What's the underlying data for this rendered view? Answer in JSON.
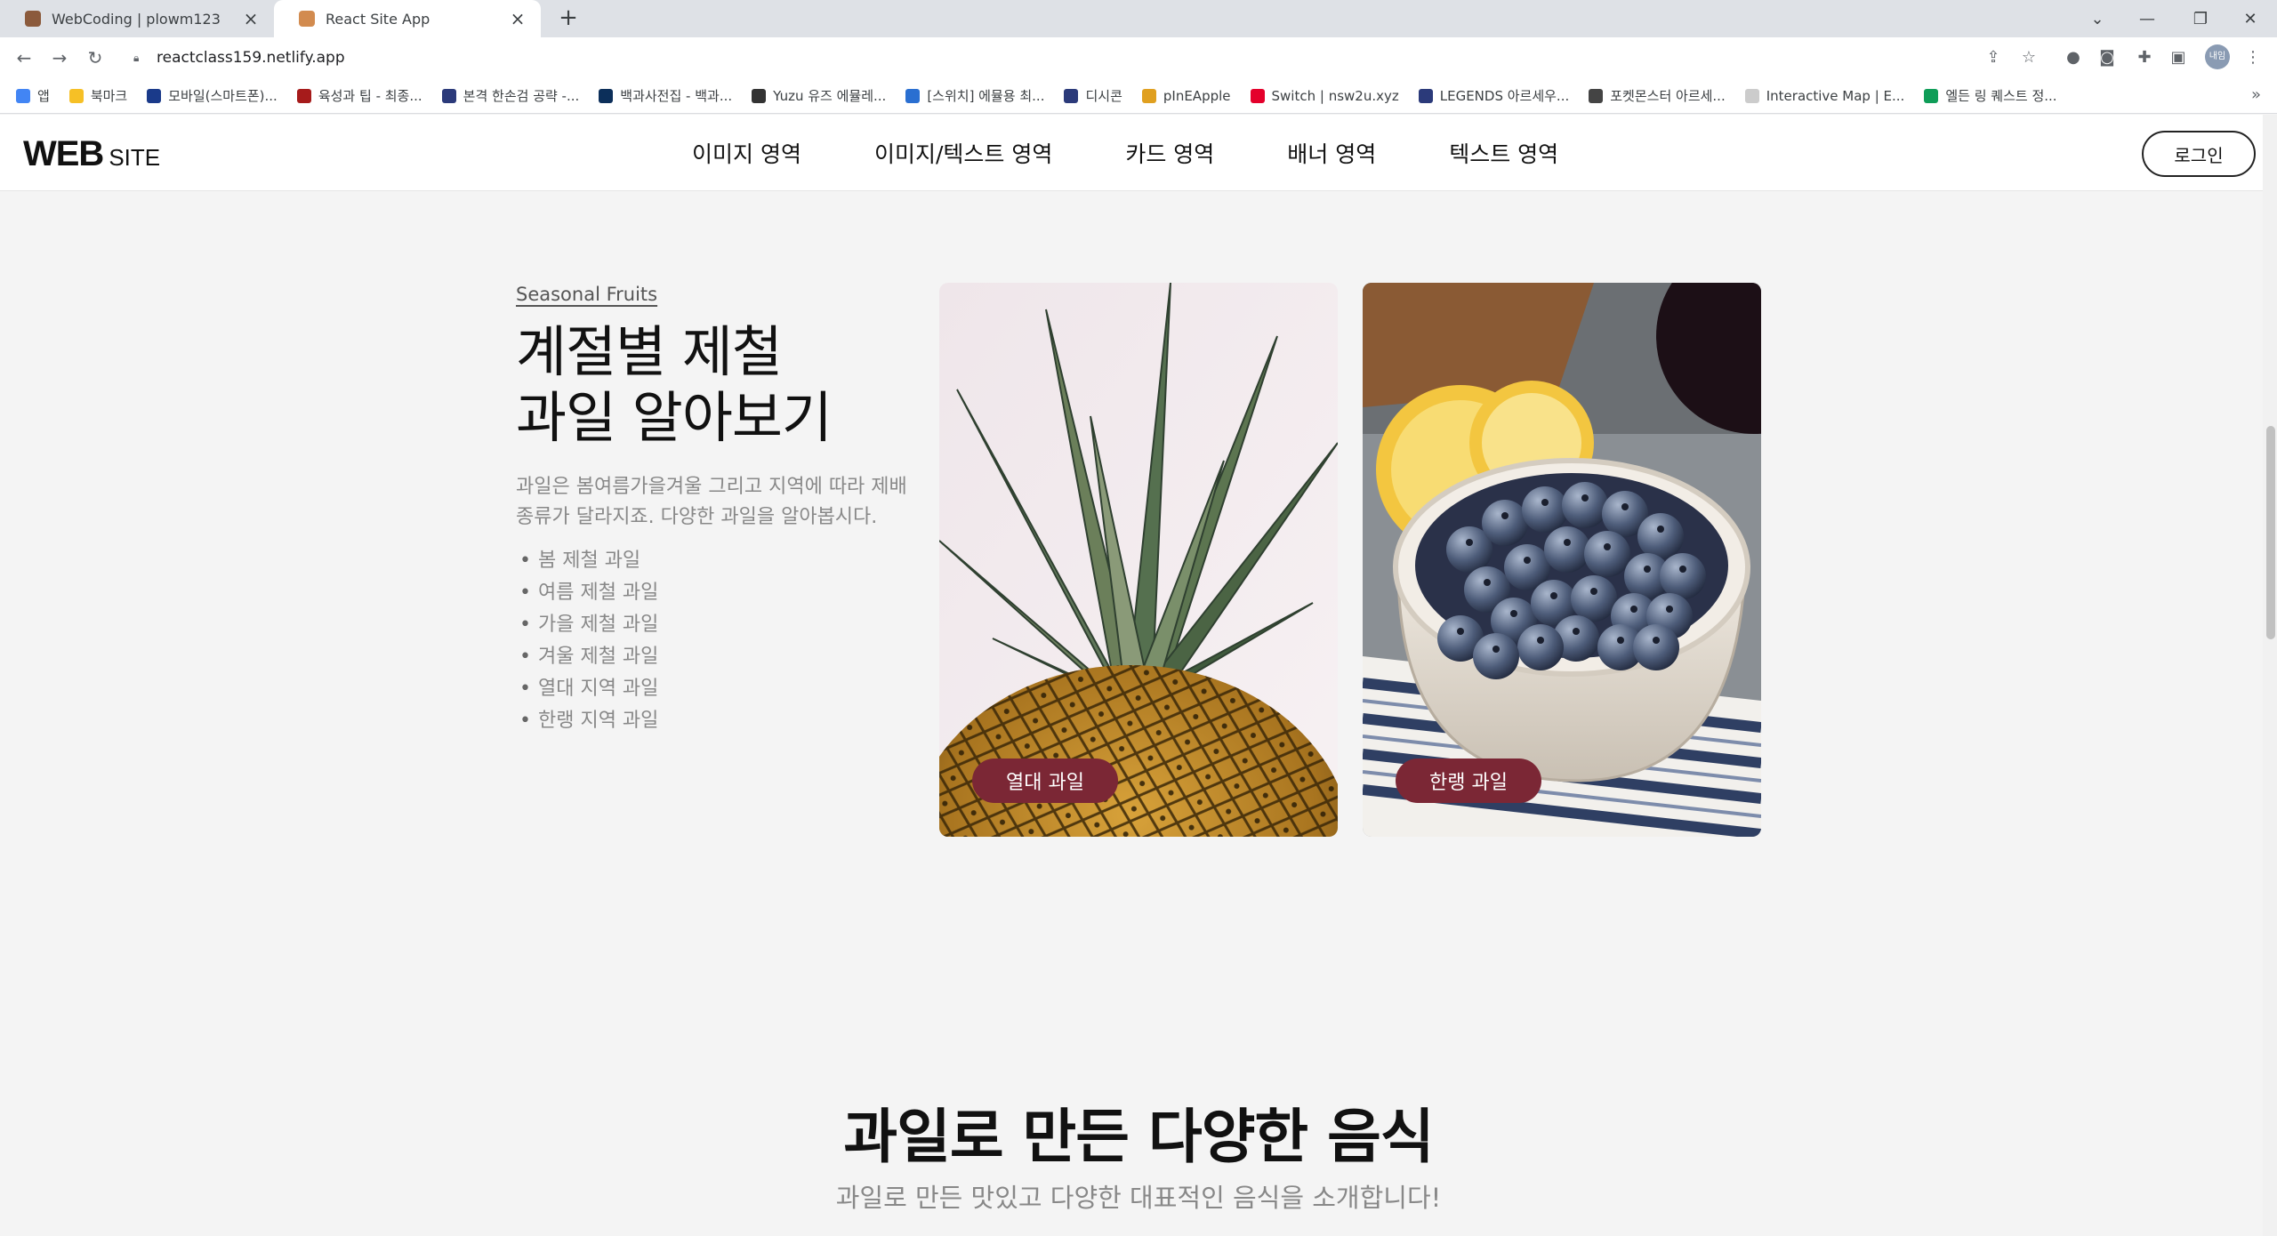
{
  "browser": {
    "tabs": [
      {
        "title": "WebCoding | plowm123",
        "active": false
      },
      {
        "title": "React Site App",
        "active": true
      }
    ],
    "url": "reactclass159.netlify.app",
    "profile_label": "내임",
    "bookmarks": [
      "앱",
      "북마크",
      "모바일(스마트폰)...",
      "육성과 팁 - 최종...",
      "본격 한손검 공략 -...",
      "백과사전집 - 백과...",
      "Yuzu 유즈 에뮬레...",
      "[스위치] 에뮬용 최...",
      "디시콘",
      "pInEApple",
      "Switch | nsw2u.xyz",
      "LEGENDS 아르세우...",
      "포켓몬스터 아르세...",
      "Interactive Map | E...",
      "엘든 링 퀘스트 정..."
    ],
    "bookmark_colors": [
      "#4285f4",
      "#f6c026",
      "#1a3a8a",
      "#a61b1b",
      "#2b3a7a",
      "#0c2f5a",
      "#333333",
      "#2a6fd1",
      "#2b3a7a",
      "#e0a020",
      "#e4002b",
      "#2b3a7a",
      "#444444",
      "#cccccc",
      "#0f9d58"
    ]
  },
  "header": {
    "logo_main": "WEB",
    "logo_sub": "SITE",
    "nav": [
      "이미지 영역",
      "이미지/텍스트 영역",
      "카드 영역",
      "배너 영역",
      "텍스트 영역"
    ],
    "login": "로그인"
  },
  "imgtext": {
    "sub": "Seasonal Fruits",
    "title_line1": "계절별 제철",
    "title_line2": "과일 알아보기",
    "desc": "과일은 봄여름가을겨울 그리고 지역에 따라 제배 종류가 달라지죠. 다양한 과일을 알아봅시다.",
    "list": [
      "봄 제철 과일",
      "여름 제철 과일",
      "가을 제철 과일",
      "겨울 제철 과일",
      "열대 지역 과일",
      "한랭 지역 과일"
    ],
    "cards": [
      {
        "label": "열대 과일",
        "image": "pineapple"
      },
      {
        "label": "한랭 과일",
        "image": "blueberries"
      }
    ],
    "accent_color": "#7b2735"
  },
  "food": {
    "title": "과일로 만든 다양한 음식",
    "desc": "과일로 만든 맛있고 다양한 대표적인 음식을 소개합니다!"
  }
}
